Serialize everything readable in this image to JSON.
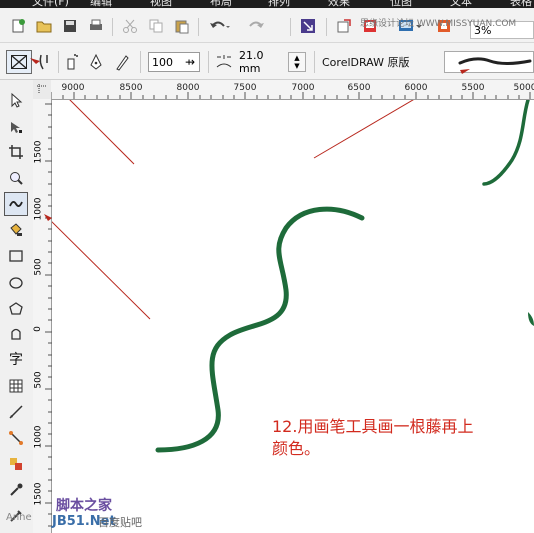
{
  "menubar": {
    "items": [
      "文件(F)",
      "编辑",
      "视图",
      "布局",
      "排列",
      "效果",
      "位图",
      "文本",
      "表格"
    ]
  },
  "toolbar_top": {
    "site_watermark": "思缘设计论坛 WWW.MISSYUAN.COM",
    "zoom_value": "3%"
  },
  "property_bar": {
    "smoothing_value": "100",
    "width_value": "21.0 mm",
    "preset_label": "CorelDRAW 原版"
  },
  "ruler": {
    "horizontal_ticks": [
      "9000",
      "8500",
      "8000",
      "7500",
      "7000",
      "6500",
      "6000",
      "5500",
      "5000"
    ],
    "vertical_ticks": [
      "1500",
      "1000",
      "500",
      "0",
      "500",
      "1000",
      "1500"
    ]
  },
  "toolbox": {
    "text_tool_glyph": "字"
  },
  "canvas": {
    "annotation_line1": "12.用画笔工具画一根藤再上",
    "annotation_line2": "颜色。",
    "vine_color": "#1e6b3a",
    "arrow_color": "#b8271d"
  },
  "watermark": {
    "site_cn": "脚本之家",
    "site_url": "JB51.Net",
    "site_small": "百度贴吧",
    "left_mark": "Anne"
  }
}
